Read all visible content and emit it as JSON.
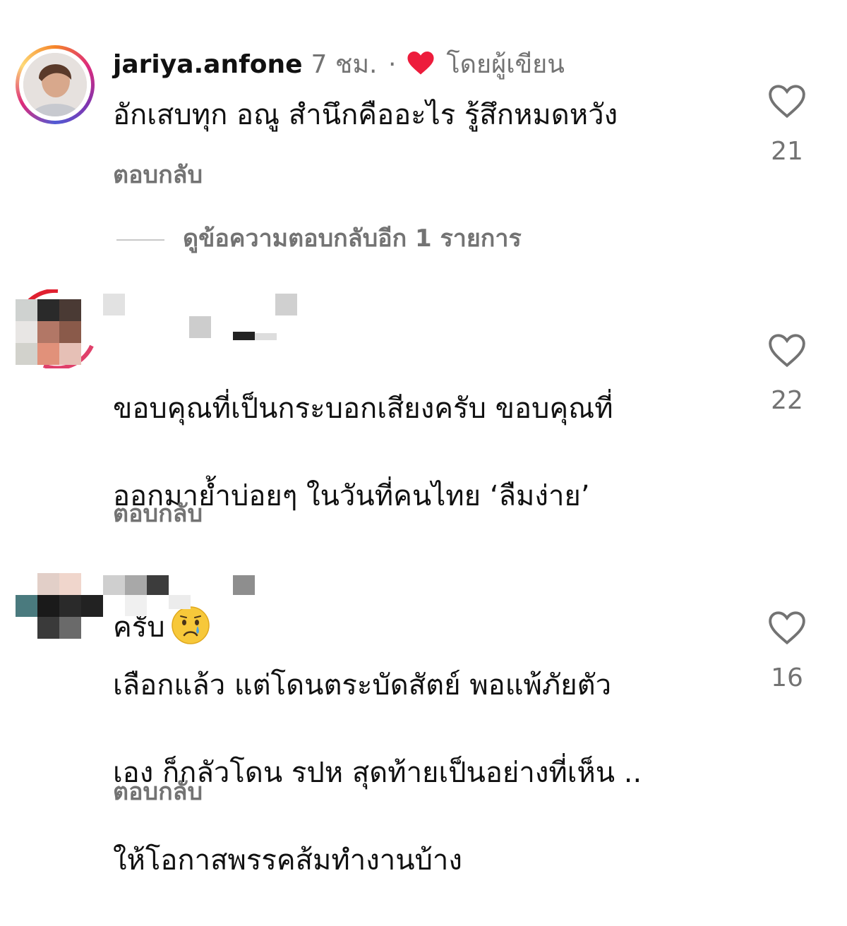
{
  "comments": [
    {
      "username": "jariya.anfone",
      "time": "7 ชม.",
      "dot": "·",
      "author_tag": "โดยผู้เขียน",
      "text": "อักเสบทุก อณู  สำนึกคืออะไร รู้สึกหมดหวัง",
      "reply_label": "ตอบกลับ",
      "likes": "21",
      "view_replies": "ดูข้อความตอบกลับอีก 1 รายการ"
    },
    {
      "username": "",
      "text_line1": "ขอบคุณที่เป็นกระบอกเสียงครับ ขอบคุณที่",
      "text_line2": "ออกมาย้ำบ่อยๆ ในวันที่คนไทย ‘ลืมง่าย’",
      "text_line3": "ครับ",
      "reply_label": "ตอบกลับ",
      "likes": "22"
    },
    {
      "username": "",
      "text_line1": "เลือกแล้ว แต่โดนตระบัดสัตย์ พอแพ้ภัยตัว",
      "text_line2": "เอง ก็กลัวโดน รปห สุดท้ายเป็นอย่างที่เห็น ..",
      "text_line3": "ให้โอกาสพรรคส้มทำงานบ้าง",
      "reply_label": "ตอบกลับ",
      "likes": "16"
    }
  ],
  "colors": {
    "heart_red": "#ed1c3c",
    "secondary_text": "#737373"
  },
  "icons": {
    "like": "heart-outline-icon",
    "author_like": "heart-filled-icon",
    "emoji": "crying-face-emoji"
  }
}
